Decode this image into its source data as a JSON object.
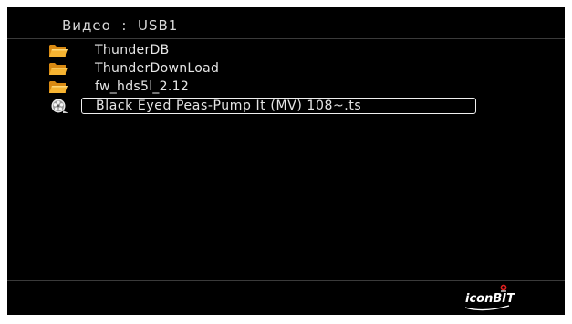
{
  "header": {
    "location": "Видео  :  USB1"
  },
  "files": [
    {
      "name": "ThunderDB",
      "type": "folder",
      "icon": "folder-icon",
      "selected": false
    },
    {
      "name": "ThunderDownLoad",
      "type": "folder",
      "icon": "folder-icon",
      "selected": false
    },
    {
      "name": "fw_hds5l_2.12",
      "type": "folder",
      "icon": "folder-icon",
      "selected": false
    },
    {
      "name": "Black Eyed Peas-Pump It (MV) 108~.ts",
      "type": "video",
      "icon": "film-reel-icon",
      "selected": true
    }
  ],
  "footer": {
    "brand_logo": "iconBIT"
  },
  "colors": {
    "background": "#000000",
    "text": "#e6e6e6",
    "folder": "#f0a020",
    "selection_border": "#f0f0f0",
    "logo_accent": "#e02020"
  }
}
